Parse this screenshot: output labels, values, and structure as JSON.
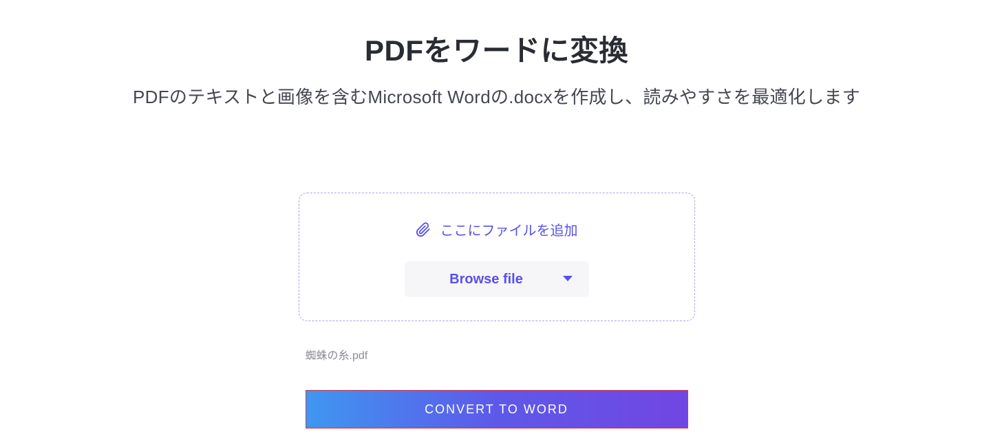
{
  "header": {
    "title": "PDFをワードに変換",
    "subtitle": "PDFのテキストと画像を含むMicrosoft Wordの.docxを作成し、読みやすさを最適化します"
  },
  "dropzone": {
    "label": "ここにファイルを追加",
    "browse_label": "Browse file"
  },
  "file": {
    "name": "蜘蛛の糸.pdf"
  },
  "actions": {
    "convert_label": "CONVERT TO WORD"
  },
  "colors": {
    "accent": "#5850ec",
    "gradient_start": "#3f97f0",
    "gradient_end": "#7146e3",
    "highlight_border": "#d43a3a"
  }
}
